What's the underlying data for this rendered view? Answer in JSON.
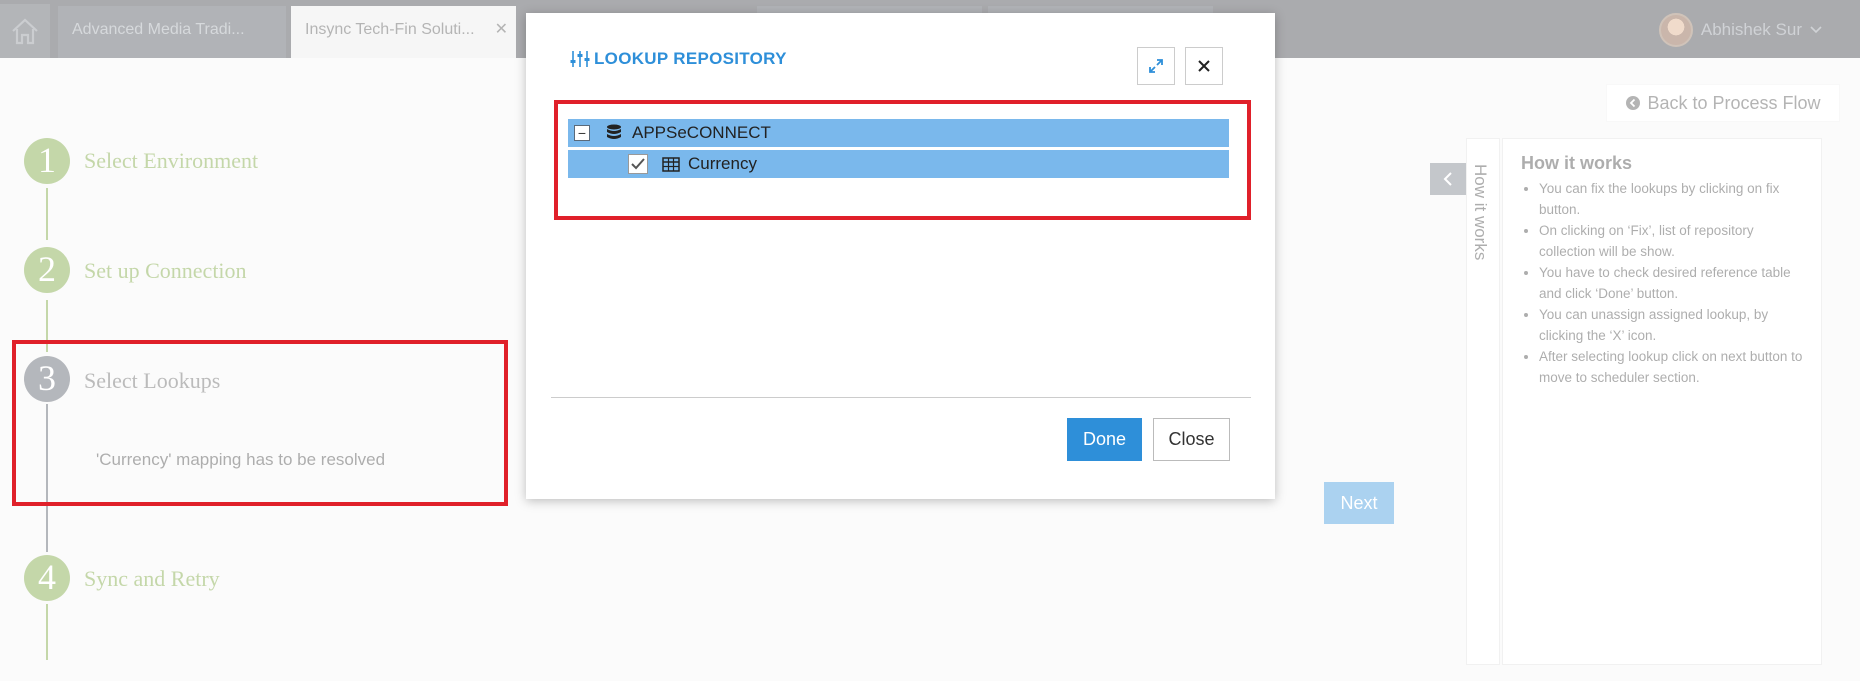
{
  "topbar": {
    "tabs": [
      {
        "label": "Advanced Media Tradi..."
      },
      {
        "label": "Insync Tech-Fin Soluti..."
      }
    ],
    "user_name": "Abhishek Sur"
  },
  "stepper": {
    "steps": [
      {
        "number": "1",
        "label": "Select Environment"
      },
      {
        "number": "2",
        "label": "Set up Connection"
      },
      {
        "number": "3",
        "label": "Select Lookups"
      },
      {
        "number": "4",
        "label": "Sync and Retry"
      }
    ],
    "current_message": "'Currency' mapping has to be resolved"
  },
  "actions": {
    "back_label": "Back to Process Flow",
    "next_label": "Next"
  },
  "how_it_works": {
    "tab_label": "How it works",
    "title": "How it works",
    "items": [
      "You can fix the lookups by clicking on fix button.",
      "On clicking on ‘Fix’, list of repository collection will be show.",
      "You have to check desired reference table and click ‘Done’ button.",
      "You can unassign assigned lookup, by clicking the ‘X’ icon.",
      "After selecting lookup click on next button to move to scheduler section."
    ]
  },
  "modal": {
    "title": "LOOKUP REPOSITORY",
    "tree": {
      "root_label": "APPSeCONNECT",
      "child_label": "Currency"
    },
    "done_label": "Done",
    "close_label": "Close"
  },
  "colors": {
    "accent": "#2e8fd9",
    "step_green": "#6d9b2a",
    "step_current": "#454b57",
    "highlight_red": "#e0202a",
    "tree_selected": "#7ab8ec"
  }
}
